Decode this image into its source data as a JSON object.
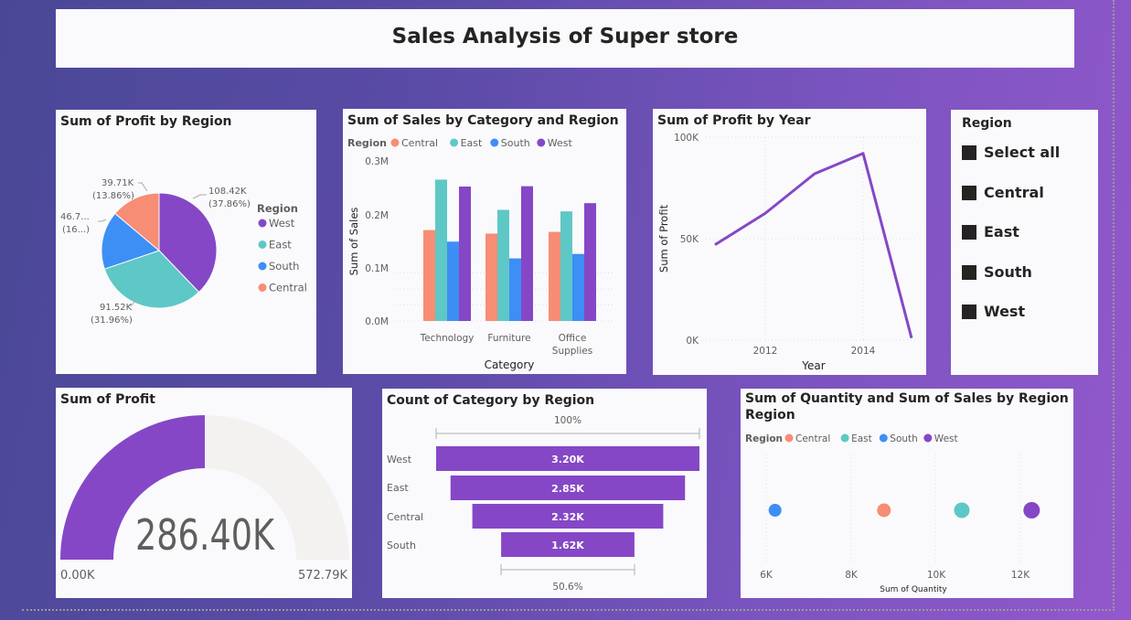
{
  "dashboard": {
    "title": "Sales Analysis of Super store"
  },
  "colors": {
    "west": "#8547c6",
    "east": "#5ec8c6",
    "south": "#3d8ef5",
    "central": "#f78d74",
    "gauge_fill": "#8547c6",
    "gauge_track": "#f3f2f1"
  },
  "pie": {
    "title": "Sum of Profit by Region",
    "legend_title": "Region",
    "labels": [
      {
        "value": "108.42K",
        "pct": "(37.86%)"
      },
      {
        "value": "91.52K",
        "pct": "(31.96%)"
      },
      {
        "value": "46.7...",
        "pct": "(16...)"
      },
      {
        "value": "39.71K",
        "pct": "(13.86%)"
      }
    ]
  },
  "bar": {
    "title": "Sum of Sales by Category and Region",
    "legend_title": "Region",
    "ylabel": "Sum of Sales",
    "xlabel": "Category",
    "yticks": [
      "0.3M",
      "0.2M",
      "0.1M",
      "0.0M"
    ],
    "category_lines": [
      [
        "Technology"
      ],
      [
        "Furniture"
      ],
      [
        "Office",
        "Supplies"
      ]
    ]
  },
  "line": {
    "title": "Sum of Profit by Year",
    "ylabel": "Sum of Profit",
    "xlabel": "Year",
    "yticks": [
      "100K",
      "50K",
      "0K"
    ],
    "xticks": [
      "2012",
      "2014"
    ]
  },
  "slicer": {
    "title": "Region",
    "items": [
      "Select all",
      "Central",
      "East",
      "South",
      "West"
    ]
  },
  "gauge": {
    "title": "Sum of Profit",
    "value_label": "286.40K",
    "min_label": "0.00K",
    "max_label": "572.79K"
  },
  "funnel": {
    "title": "Count of Category by Region",
    "top_pct": "100%",
    "bottom_pct": "50.6%",
    "rows": [
      {
        "label": "West",
        "value_label": "3.20K"
      },
      {
        "label": "East",
        "value_label": "2.85K"
      },
      {
        "label": "Central",
        "value_label": "2.32K"
      },
      {
        "label": "South",
        "value_label": "1.62K"
      }
    ]
  },
  "scatter": {
    "title_lines": [
      "Sum of Quantity and Sum of Sales by Region and",
      "Region"
    ],
    "legend_title": "Region",
    "xlabel": "Sum of Quantity",
    "xticks": [
      "6K",
      "8K",
      "10K",
      "12K"
    ]
  },
  "chart_data": [
    {
      "type": "pie",
      "title": "Sum of Profit by Region",
      "categories": [
        "West",
        "East",
        "South",
        "Central"
      ],
      "values": [
        108418.45,
        91522.78,
        46749.43,
        39706.36
      ],
      "percent": [
        37.86,
        31.96,
        16.32,
        13.86
      ],
      "legend": [
        "West",
        "East",
        "South",
        "Central"
      ],
      "legend_position": "right"
    },
    {
      "type": "bar",
      "title": "Sum of Sales by Category and Region",
      "xlabel": "Category",
      "ylabel": "Sum of Sales",
      "ylim": [
        0,
        300000
      ],
      "categories": [
        "Technology",
        "Furniture",
        "Office Supplies"
      ],
      "series": [
        {
          "name": "Central",
          "values": [
            170416,
            163797,
            167026
          ]
        },
        {
          "name": "East",
          "values": [
            264974,
            208291,
            205516
          ]
        },
        {
          "name": "South",
          "values": [
            148772,
            117299,
            125651
          ]
        },
        {
          "name": "West",
          "values": [
            251992,
            252613,
            220853
          ]
        }
      ],
      "legend_position": "top-left",
      "grid": true
    },
    {
      "type": "line",
      "title": "Sum of Profit by Year",
      "xlabel": "Year",
      "ylabel": "Sum of Profit",
      "ylim": [
        0,
        100000
      ],
      "x": [
        2011,
        2012,
        2013,
        2014,
        2015
      ],
      "series": [
        {
          "values": [
            47000,
            62500,
            82000,
            92000,
            1000
          ]
        }
      ],
      "grid": true
    },
    {
      "type": "gauge",
      "title": "Sum of Profit",
      "value": 286397.02,
      "min": 0,
      "max": 572794.04
    },
    {
      "type": "funnel",
      "title": "Count of Category by Region",
      "categories": [
        "West",
        "East",
        "Central",
        "South"
      ],
      "values": [
        3200,
        2850,
        2320,
        1620
      ]
    },
    {
      "type": "scatter",
      "title": "Sum of Quantity and Sum of Sales by Region and Region",
      "xlabel": "Sum of Quantity",
      "xlim": [
        5500,
        13000
      ],
      "series": [
        {
          "name": "South",
          "x": [
            6209
          ],
          "y": [
            391722
          ]
        },
        {
          "name": "Central",
          "x": [
            8780
          ],
          "y": [
            501240
          ]
        },
        {
          "name": "East",
          "x": [
            10618
          ],
          "y": [
            678781
          ]
        },
        {
          "name": "West",
          "x": [
            12266
          ],
          "y": [
            725458
          ]
        }
      ],
      "legend_position": "top-left"
    }
  ]
}
